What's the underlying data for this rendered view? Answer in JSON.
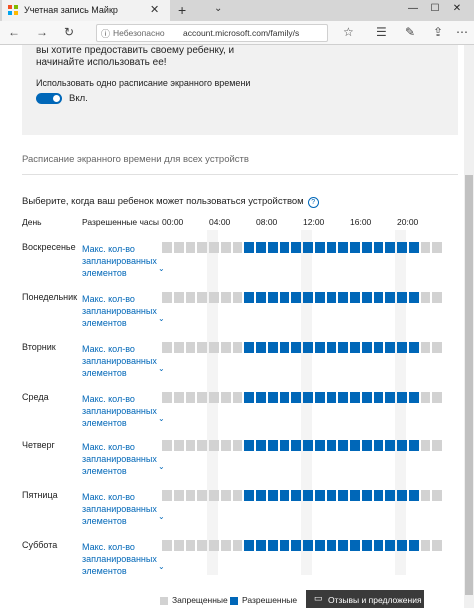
{
  "browser": {
    "tab_title": "Учетная запись Майкр",
    "insecure_label": "Небезопасно",
    "url": "account.microsoft.com/family/s"
  },
  "panel": {
    "line1": "вы хотите предоставить своему ребенку, и",
    "line2": "начинайте использовать ее!",
    "toggle_label": "Использовать одно расписание экранного времени",
    "toggle_state": "Вкл.",
    "toggle_on": true
  },
  "section_title": "Расписание экранного времени для всех устройств",
  "question": "Выберите, когда ваш ребенок может пользоваться устройством",
  "table": {
    "day_header": "День",
    "allowed_header": "Разрешенные часы",
    "time_labels": [
      "00:00",
      "04:00",
      "08:00",
      "12:00",
      "16:00",
      "20:00"
    ],
    "limit_line1": "Макс. кол-во",
    "limit_line2": "запланированных",
    "limit_line3": "элементов",
    "days": [
      "Воскресенье",
      "Понедельник",
      "Вторник",
      "Среда",
      "Четверг",
      "Пятница",
      "Суббота"
    ],
    "slot_count": 24,
    "allowed_from_hour": 7,
    "allowed_to_hour": 22
  },
  "legend": {
    "blocked": "Запрещенные",
    "allowed": "Разрешенные"
  },
  "feedback_label": "Отзывы и предложения",
  "colors": {
    "allowed": "#0067b8",
    "blocked": "#d2d2d2",
    "link": "#0067b8"
  }
}
